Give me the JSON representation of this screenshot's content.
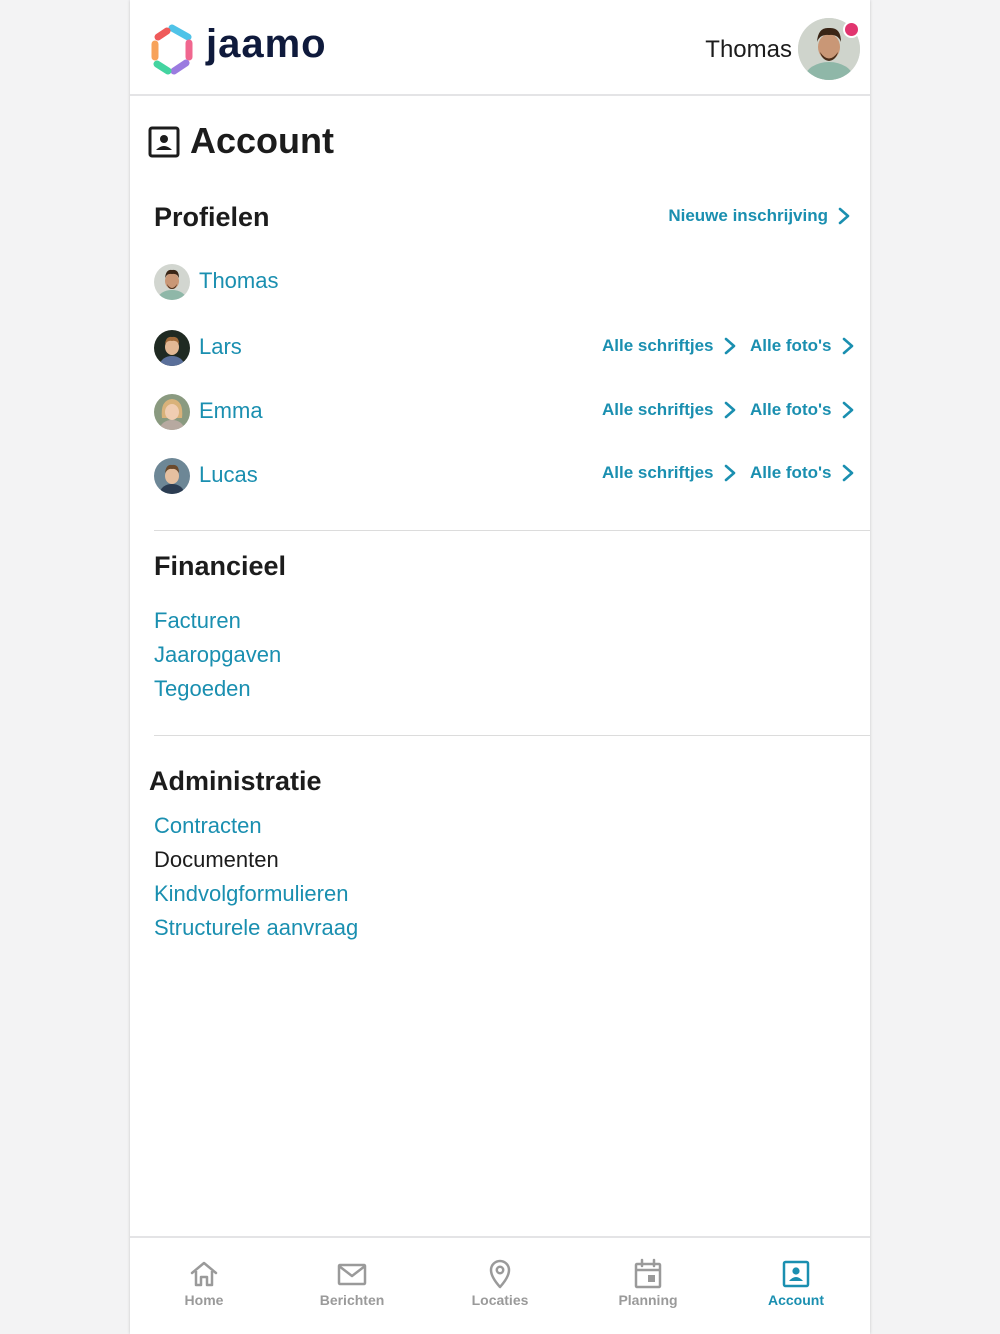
{
  "header": {
    "brand": "jaamo",
    "user_name": "Thomas"
  },
  "page": {
    "title": "Account"
  },
  "profiles": {
    "title": "Profielen",
    "new_enrollment": "Nieuwe inschrijving",
    "items": [
      {
        "name": "Thomas",
        "writings": "",
        "photos": ""
      },
      {
        "name": "Lars",
        "writings": "Alle schriftjes",
        "photos": "Alle foto's"
      },
      {
        "name": "Emma",
        "writings": "Alle schriftjes",
        "photos": "Alle foto's"
      },
      {
        "name": "Lucas",
        "writings": "Alle schriftjes",
        "photos": "Alle foto's"
      }
    ]
  },
  "financial": {
    "title": "Financieel",
    "links": [
      "Facturen",
      "Jaaropgaven",
      "Tegoeden"
    ]
  },
  "administration": {
    "title": "Administratie",
    "links": [
      "Contracten",
      "Documenten",
      "Kindvolgformulieren",
      "Structurele aanvraag"
    ]
  },
  "tabbar": {
    "tabs": [
      {
        "label": "Home",
        "icon": "home-icon"
      },
      {
        "label": "Berichten",
        "icon": "mail-icon"
      },
      {
        "label": "Locaties",
        "icon": "location-pin-icon"
      },
      {
        "label": "Planning",
        "icon": "calendar-icon"
      },
      {
        "label": "Account",
        "icon": "account-icon"
      }
    ],
    "active": "Account"
  },
  "colors": {
    "accent": "#1a8fb0",
    "brand_text": "#0f1a3c",
    "notification": "#e1356f",
    "inactive": "#9a9a9a"
  }
}
